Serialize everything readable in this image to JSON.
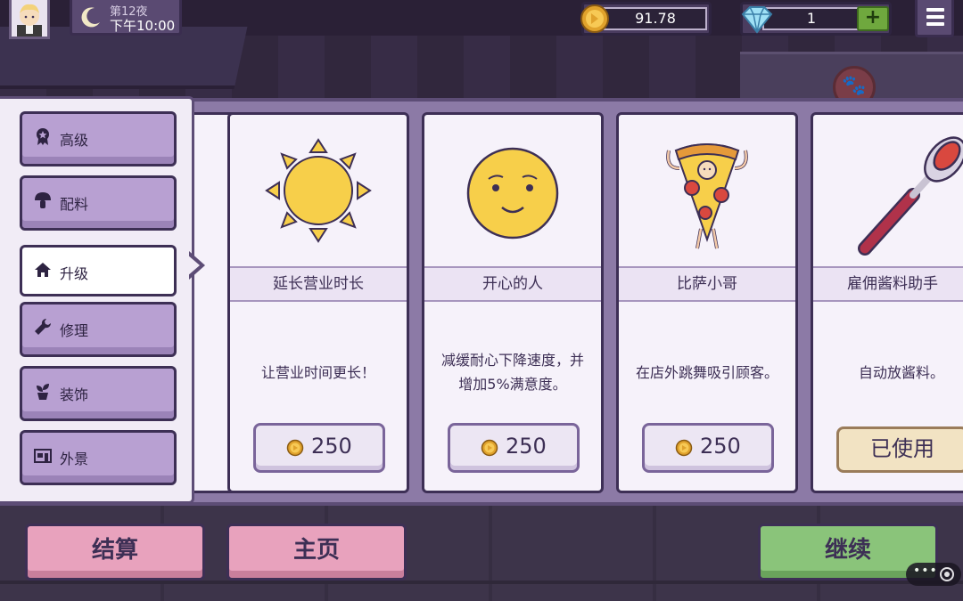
{
  "hud": {
    "night": "第12夜",
    "time": "下午10:00",
    "coins": "91.78",
    "gems": "1",
    "gem_plus": "+"
  },
  "tabs": [
    {
      "label": "高级",
      "icon": "award-icon",
      "active": false
    },
    {
      "label": "配料",
      "icon": "mushroom-icon",
      "active": false
    },
    {
      "label": "升级",
      "icon": "home-icon",
      "active": true
    },
    {
      "label": "修理",
      "icon": "wrench-icon",
      "active": false
    },
    {
      "label": "装饰",
      "icon": "plant-icon",
      "active": false
    },
    {
      "label": "外景",
      "icon": "storefront-icon",
      "active": false
    }
  ],
  "cards": [
    {
      "title": "延长营业时长",
      "desc": "让营业时间更长！",
      "price": "250",
      "icon": "sun-icon"
    },
    {
      "title": "开心的人",
      "desc": "减缓耐心下降速度，并增加5%满意度。",
      "price": "250",
      "icon": "smiley-icon"
    },
    {
      "title": "比萨小哥",
      "desc": "在店外跳舞吸引顾客。",
      "price": "250",
      "icon": "pizza-mascot-icon"
    },
    {
      "title": "雇佣酱料助手",
      "desc": "自动放酱料。",
      "used_label": "已使用",
      "icon": "sauce-spoon-icon"
    }
  ],
  "buttons": {
    "checkout": "结算",
    "home": "主页",
    "continue": "继续"
  },
  "colors": {
    "panel": "#8c7aa6",
    "tab": "#b8a0d2",
    "pink_button": "#e8a2bd",
    "green_button": "#8ac47a",
    "coin": "#f5c542"
  }
}
